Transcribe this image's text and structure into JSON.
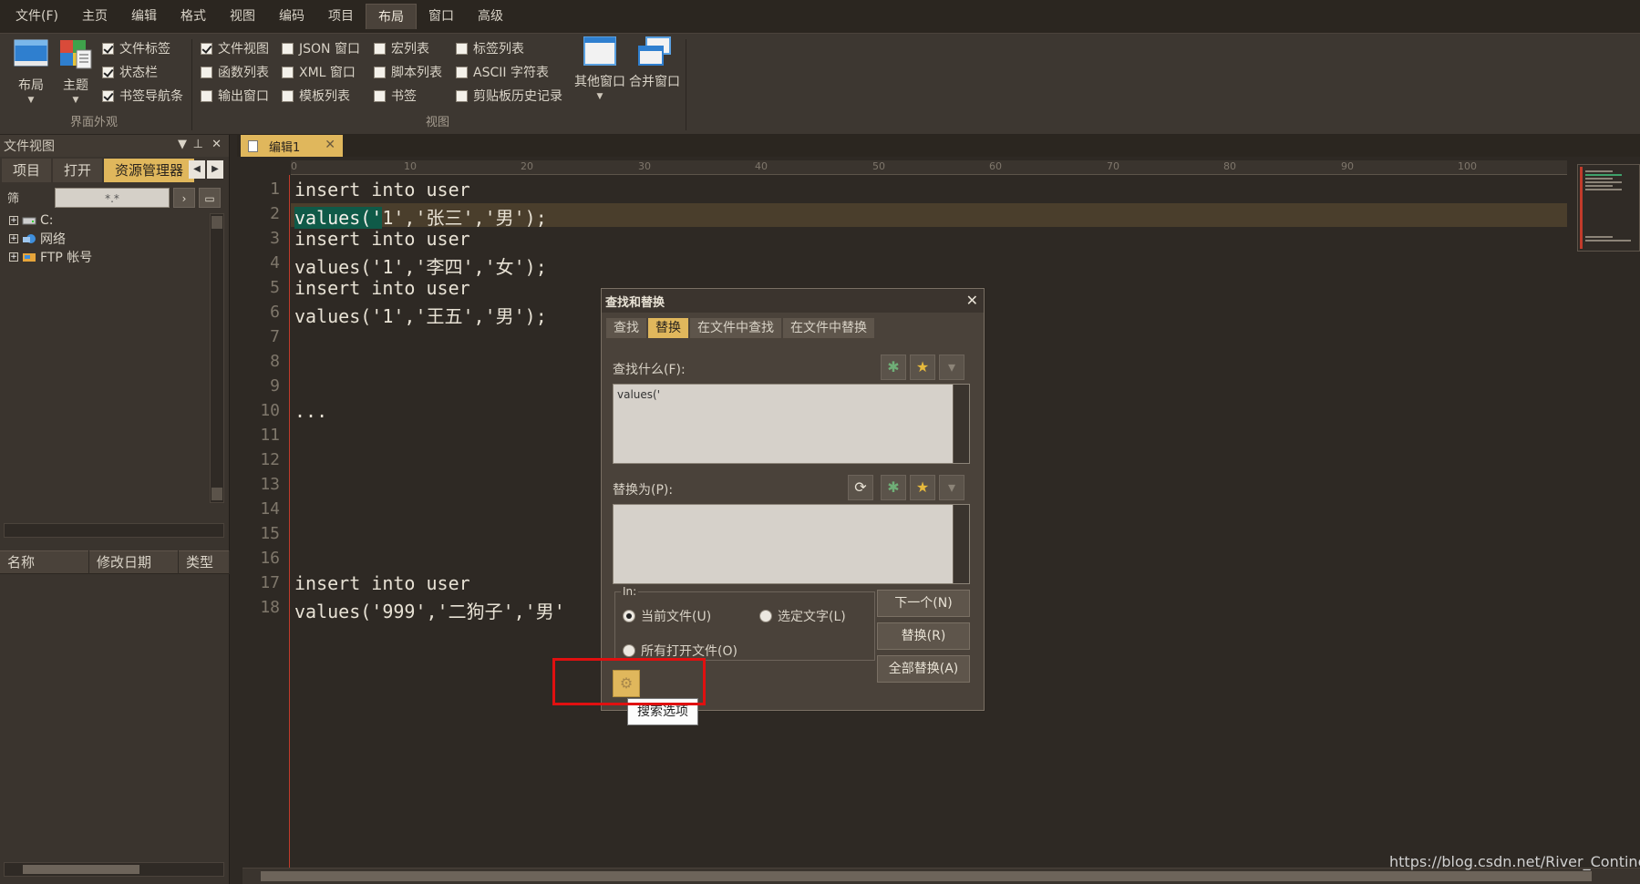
{
  "menu": [
    "文件(F)",
    "主页",
    "编辑",
    "格式",
    "视图",
    "编码",
    "项目",
    "布局",
    "窗口",
    "高级"
  ],
  "active_menu": "布局",
  "ribbon": {
    "layout_label": "布局",
    "theme_label": "主题",
    "appearance_group": "界面外观",
    "view_group": "视图",
    "appearance_checks": [
      {
        "label": "文件标签",
        "checked": true
      },
      {
        "label": "状态栏",
        "checked": true
      },
      {
        "label": "书签导航条",
        "checked": true
      }
    ],
    "view_checks_col1": [
      {
        "label": "文件视图",
        "checked": true
      },
      {
        "label": "函数列表",
        "checked": false
      },
      {
        "label": "输出窗口",
        "checked": false
      }
    ],
    "view_checks_col2": [
      {
        "label": "JSON 窗口",
        "checked": false
      },
      {
        "label": "XML 窗口",
        "checked": false
      },
      {
        "label": "模板列表",
        "checked": false
      }
    ],
    "view_checks_col3": [
      {
        "label": "宏列表",
        "checked": false
      },
      {
        "label": "脚本列表",
        "checked": false
      },
      {
        "label": "书签",
        "checked": false
      }
    ],
    "view_checks_col4": [
      {
        "label": "标签列表",
        "checked": false
      },
      {
        "label": "ASCII 字符表",
        "checked": false
      },
      {
        "label": "剪贴板历史记录",
        "checked": false
      }
    ],
    "other_windows": "其他窗口",
    "merge_windows": "合并窗口"
  },
  "file_view": {
    "title": "文件视图",
    "tabs": [
      "项目",
      "打开",
      "资源管理器"
    ],
    "active_tab": "资源管理器",
    "filter_label": "筛",
    "filter_value": "*.*",
    "tree": [
      "C:",
      "网络",
      "FTP 帐号"
    ],
    "columns": [
      "名称",
      "修改日期",
      "类型"
    ]
  },
  "editor": {
    "tab_title": "编辑1",
    "ruler_marks": [
      "0",
      "10",
      "20",
      "30",
      "40",
      "50",
      "60",
      "70",
      "80",
      "90",
      "100"
    ],
    "line_numbers": [
      "1",
      "2",
      "3",
      "4",
      "5",
      "6",
      "7",
      "8",
      "9",
      "10",
      "11",
      "12",
      "13",
      "14",
      "15",
      "16",
      "17",
      "18"
    ],
    "lines": [
      "insert into user",
      "values('1','张三','男');",
      "insert into user",
      "values('1','李四','女');",
      "insert into user",
      "values('1','王五','男');",
      "",
      "",
      "",
      "...",
      "",
      "",
      "",
      "",
      "",
      "",
      "insert into user",
      "values('999','二狗子','男'"
    ],
    "highlight_text": "values('"
  },
  "dialog": {
    "title": "查找和替换",
    "tabs": [
      "查找",
      "替换",
      "在文件中查找",
      "在文件中替换"
    ],
    "active_tab": "替换",
    "find_label": "查找什么(F):",
    "find_value": "values('",
    "replace_label": "替换为(P):",
    "replace_value": "",
    "in_label": "In:",
    "scope_options": [
      {
        "label": "当前文件(U)",
        "selected": true
      },
      {
        "label": "选定文字(L)",
        "selected": false
      },
      {
        "label": "所有打开文件(O)",
        "selected": false
      }
    ],
    "buttons": [
      "下一个(N)",
      "替换(R)",
      "全部替换(A)"
    ],
    "tooltip": "搜索选项"
  },
  "watermark": "https://blog.csdn.net/River_Continent",
  "colors": {
    "accent": "#e0b75c",
    "background": "#2e2924",
    "highlight": "#0f5a48",
    "annotation": "#e01010"
  }
}
